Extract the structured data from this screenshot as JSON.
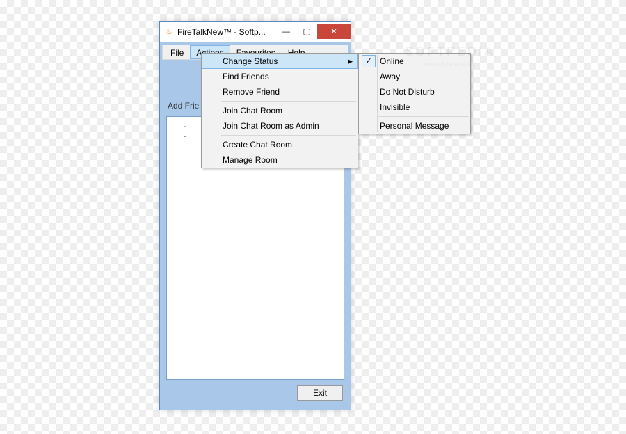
{
  "window": {
    "title": "FireTalkNew™ - Softp..."
  },
  "menubar": {
    "file": "File",
    "actions": "Actions",
    "favourites": "Favourites",
    "help": "Help"
  },
  "content": {
    "add_friend": "Add Frie",
    "dash1": "-",
    "dash2": "-",
    "exit": "Exit"
  },
  "actions_menu": {
    "change_status": "Change Status",
    "find_friends": "Find Friends",
    "remove_friend": "Remove Friend",
    "join_chat_room": "Join Chat Room",
    "join_chat_room_admin": "Join Chat Room as Admin",
    "create_chat_room": "Create Chat  Room",
    "manage_room": "Manage Room"
  },
  "status_submenu": {
    "online": "Online",
    "away": "Away",
    "dnd": "Do Not Disturb",
    "invisible": "Invisible",
    "personal": "Personal Message"
  },
  "icons": {
    "flame": "♨",
    "arrow_right": "▶",
    "check": "✓",
    "min": "—",
    "max": "▢",
    "close": "✕"
  }
}
